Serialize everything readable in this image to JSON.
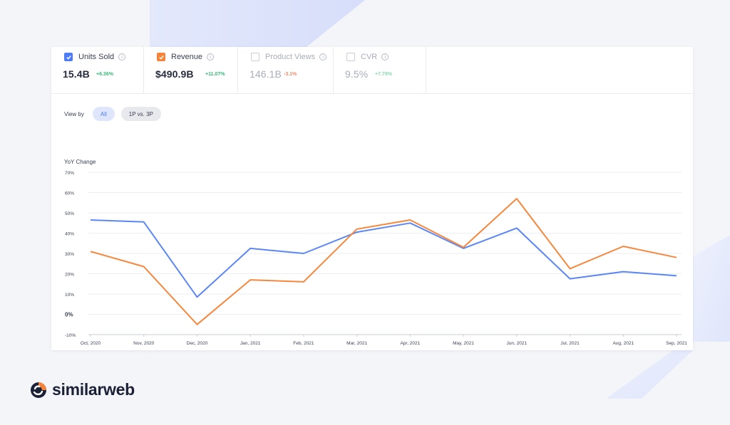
{
  "metrics": [
    {
      "label": "Units Sold",
      "value": "15.4B",
      "delta": "+6.36%",
      "direction": "up",
      "checked": true,
      "color": "#4e7cf6"
    },
    {
      "label": "Revenue",
      "value": "$490.9B",
      "delta": "+11.07%",
      "direction": "up",
      "checked": true,
      "color": "#f6833a"
    },
    {
      "label": "Product Views",
      "value": "146.1B",
      "delta": "-3.1%",
      "direction": "down",
      "checked": false,
      "color": "#c9cdd6"
    },
    {
      "label": "CVR",
      "value": "9.5%",
      "delta": "+7.79%",
      "direction": "up",
      "checked": false,
      "color": "#c9cdd6"
    }
  ],
  "view_by": {
    "label": "View by",
    "options": [
      {
        "label": "All",
        "active": true
      },
      {
        "label": "1P vs. 3P",
        "active": false
      }
    ]
  },
  "brand": {
    "name": "similarweb"
  },
  "chart_data": {
    "type": "line",
    "title": "",
    "ylabel": "YoY Change",
    "xlabel": "",
    "ylim": [
      -10,
      70
    ],
    "yticks": [
      -10,
      0,
      10,
      20,
      30,
      40,
      50,
      60,
      70
    ],
    "ytick_labels": [
      "-10%",
      "0%",
      "10%",
      "20%",
      "30%",
      "40%",
      "50%",
      "60%",
      "70%"
    ],
    "grid": true,
    "categories": [
      "Oct, 2020",
      "Nov, 2020",
      "Dec, 2020",
      "Jan, 2021",
      "Feb, 2021",
      "Mar, 2021",
      "Apr, 2021",
      "May, 2021",
      "Jun, 2021",
      "Jul, 2021",
      "Aug, 2021",
      "Sep, 2021"
    ],
    "series": [
      {
        "metric": "Units Sold",
        "color": "#5b86f5",
        "values": [
          46.5,
          45.5,
          8.5,
          32.5,
          30,
          40.5,
          45,
          32.5,
          42.5,
          17.5,
          21,
          19
        ]
      },
      {
        "metric": "Revenue",
        "color": "#f6883d",
        "values": [
          31,
          23.5,
          -5,
          17,
          16,
          42,
          46.5,
          33,
          57,
          22.5,
          33.5,
          28
        ]
      }
    ]
  }
}
